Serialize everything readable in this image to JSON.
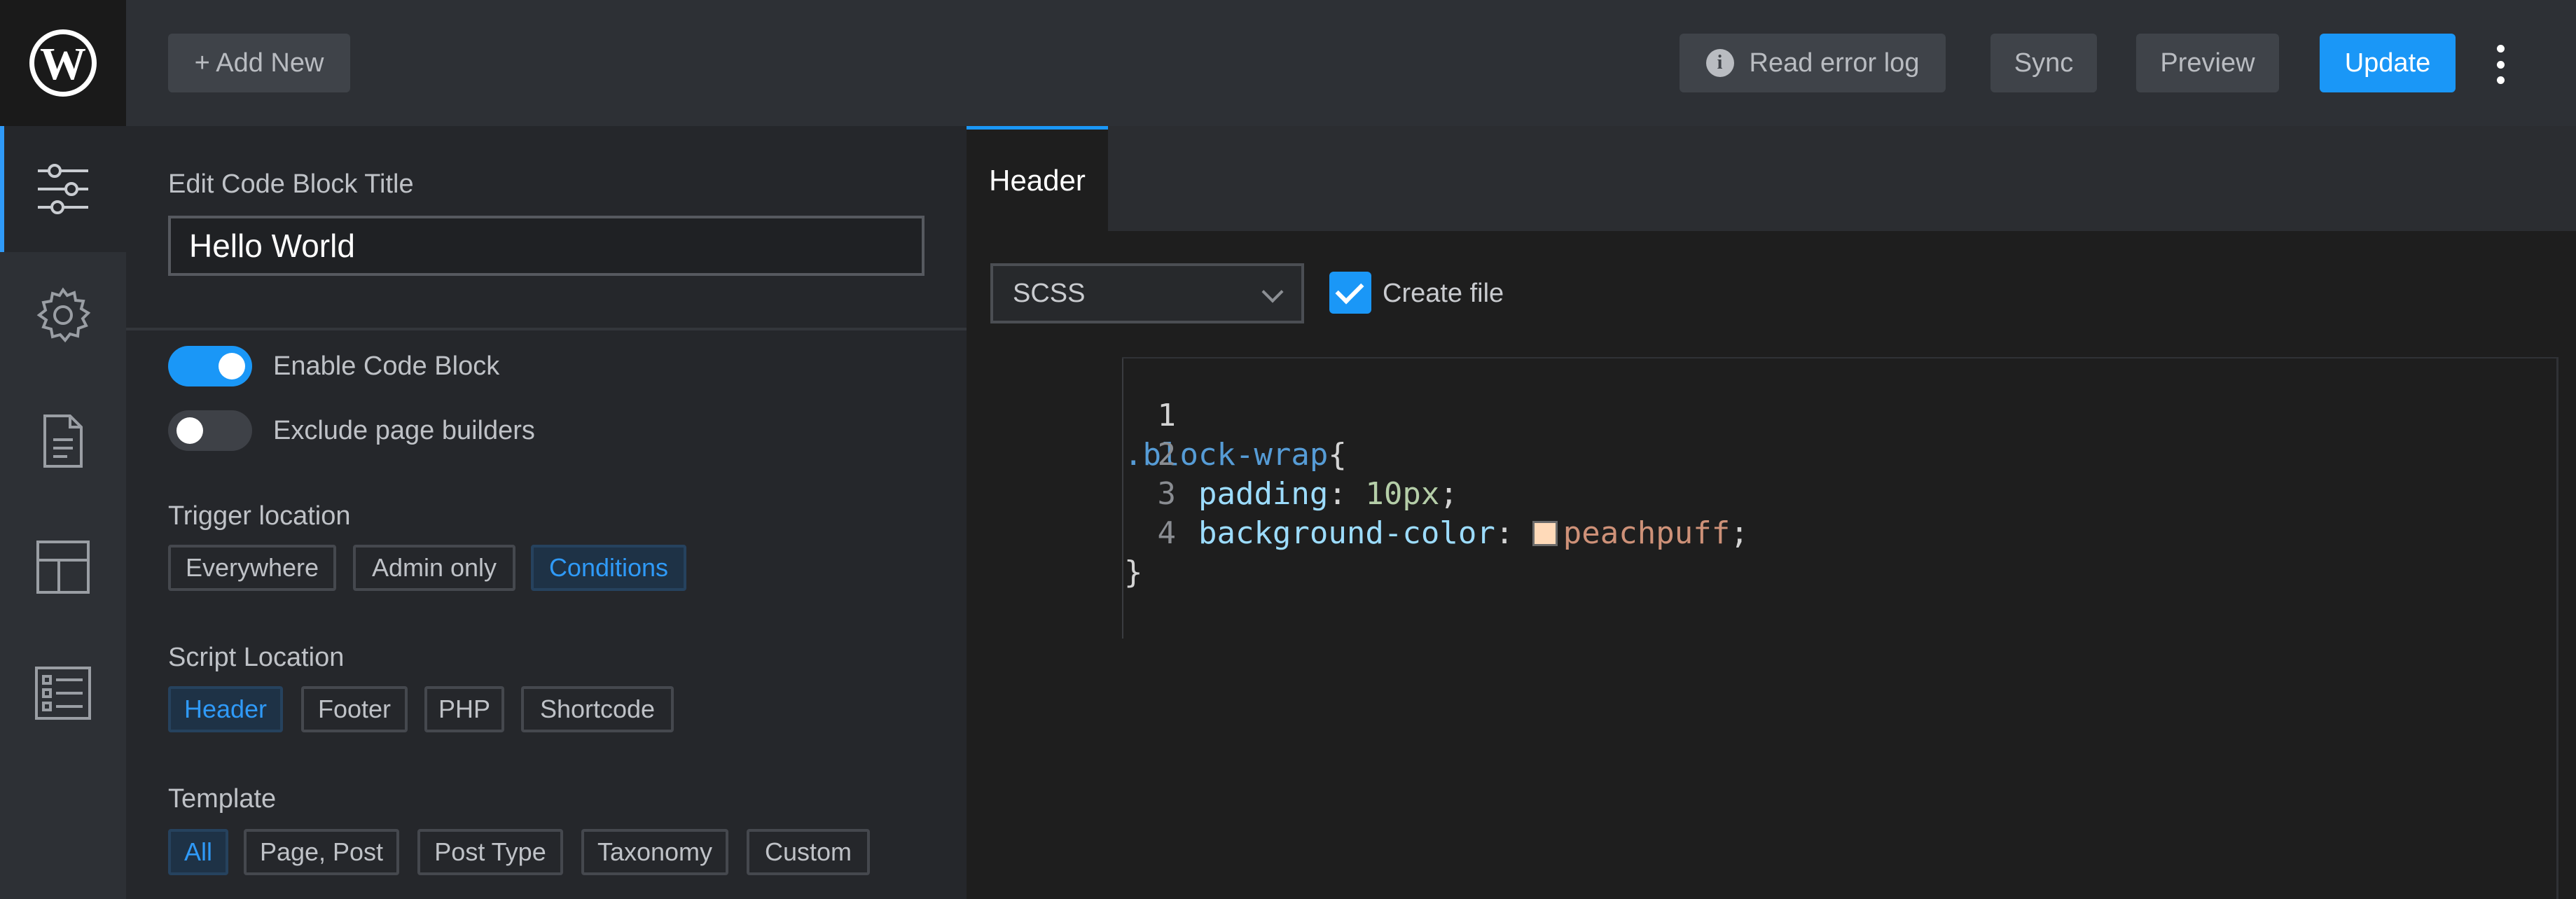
{
  "app": {
    "logo": "wordpress-logo"
  },
  "rail": {
    "items": [
      {
        "icon": "sliders-icon",
        "active": true
      },
      {
        "icon": "gear-icon",
        "active": false
      },
      {
        "icon": "document-icon",
        "active": false
      },
      {
        "icon": "layout-icon",
        "active": false
      },
      {
        "icon": "list-icon",
        "active": false
      }
    ]
  },
  "toolbar": {
    "add_new": "+ Add New",
    "read_error_log": "Read error log",
    "sync": "Sync",
    "preview": "Preview",
    "update": "Update",
    "more_icon": "kebab-menu-icon"
  },
  "panel": {
    "edit_title_label": "Edit Code Block Title",
    "title_value": "Hello World",
    "enable_label": "Enable Code Block",
    "enable_on": true,
    "exclude_label": "Exclude page builders",
    "exclude_on": false,
    "trigger": {
      "label": "Trigger location",
      "options": [
        "Everywhere",
        "Admin only",
        "Conditions"
      ],
      "selected": "Conditions"
    },
    "script": {
      "label": "Script Location",
      "options": [
        "Header",
        "Footer",
        "PHP",
        "Shortcode"
      ],
      "selected": "Header"
    },
    "template": {
      "label": "Template",
      "options": [
        "All",
        "Page, Post",
        "Post Type",
        "Taxonomy",
        "Custom"
      ],
      "selected": "All"
    }
  },
  "editor": {
    "tab_label": "Header",
    "language": "SCSS",
    "create_file_label": "Create file",
    "create_file_checked": true,
    "line_numbers": [
      "1",
      "2",
      "3",
      "4"
    ],
    "code": {
      "selector": ".block-wrap",
      "open_brace": "{",
      "prop1": "padding",
      "val1": "10px",
      "prop2": "background-color",
      "val2": "peachpuff",
      "close_brace": "}"
    },
    "colors": {
      "swatch": "#ffdab9",
      "accent": "#1a97f7"
    }
  }
}
